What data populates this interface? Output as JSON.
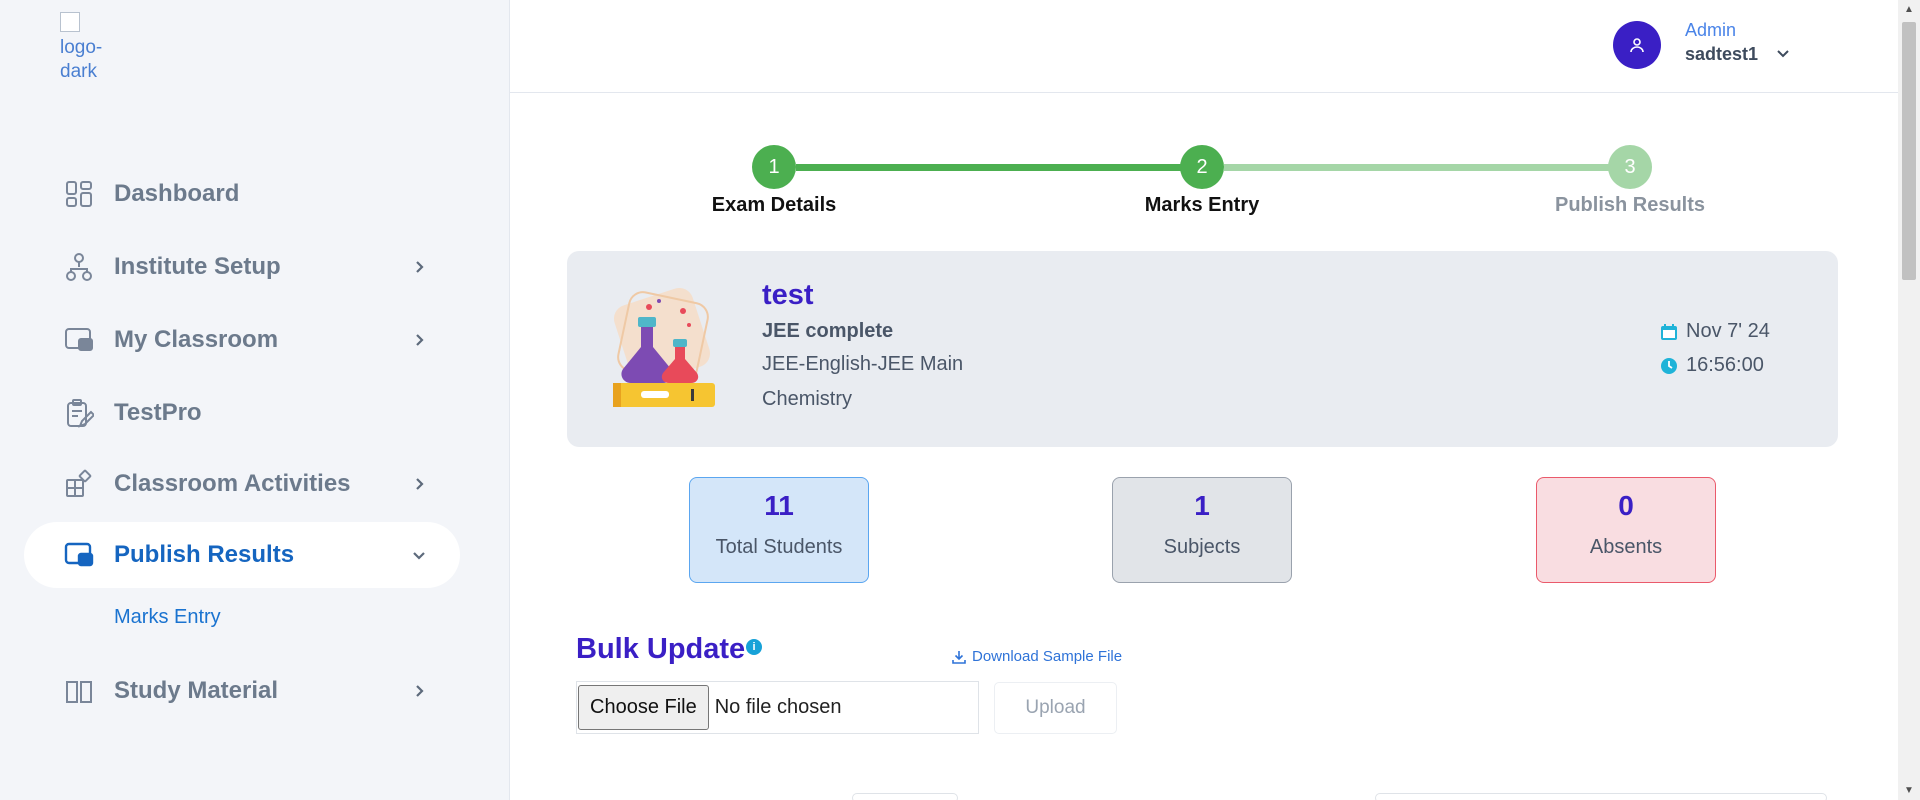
{
  "sidebar": {
    "logo_alt": "logo-dark",
    "items": [
      {
        "label": "Dashboard",
        "icon": "dashboard-icon"
      },
      {
        "label": "Institute Setup",
        "icon": "hierarchy-icon"
      },
      {
        "label": "My Classroom",
        "icon": "classroom-icon"
      },
      {
        "label": "TestPro",
        "icon": "clipboard-edit-icon"
      },
      {
        "label": "Classroom Activities",
        "icon": "activities-icon"
      },
      {
        "label": "Publish Results",
        "icon": "publish-icon"
      },
      {
        "label": "Study Material",
        "icon": "book-icon"
      }
    ],
    "sub_items": [
      {
        "label": "Marks Entry"
      }
    ]
  },
  "header": {
    "user_role": "Admin",
    "user_name": "sadtest1"
  },
  "stepper": {
    "steps": [
      {
        "number": "1",
        "label": "Exam Details"
      },
      {
        "number": "2",
        "label": "Marks Entry"
      },
      {
        "number": "3",
        "label": "Publish Results"
      }
    ],
    "colors": {
      "done": "#4caf50",
      "pending": "#a5d6a7"
    }
  },
  "exam": {
    "title": "test",
    "course": "JEE complete",
    "batch": "JEE-English-JEE Main",
    "subject": "Chemistry",
    "date": "Nov 7' 24",
    "time": "16:56:00"
  },
  "stats": [
    {
      "value": "11",
      "label": "Total Students"
    },
    {
      "value": "1",
      "label": "Subjects"
    },
    {
      "value": "0",
      "label": "Absents"
    }
  ],
  "bulk": {
    "title": "Bulk Update",
    "info": "i",
    "download_label": "Download Sample File",
    "choose_label": "Choose File",
    "file_status": "No file chosen",
    "upload_label": "Upload"
  },
  "colors": {
    "accent": "#3a1fc5",
    "link": "#1565c0",
    "info": "#17a2d8"
  }
}
